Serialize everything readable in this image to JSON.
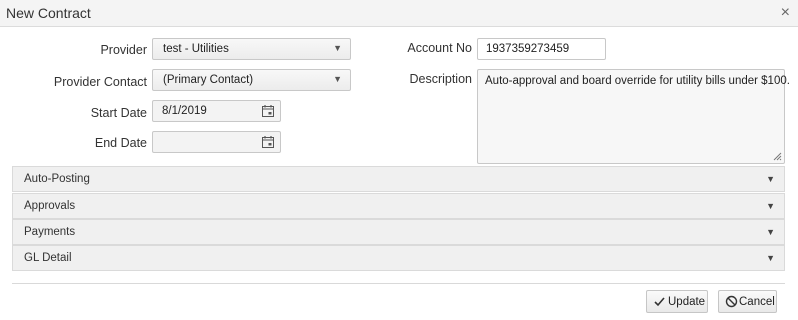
{
  "dialog": {
    "title": "New Contract"
  },
  "form": {
    "provider_label": "Provider",
    "provider_value": "test - Utilities",
    "provider_contact_label": "Provider Contact",
    "provider_contact_value": "(Primary Contact)",
    "start_date_label": "Start Date",
    "start_date_value": "8/1/2019",
    "end_date_label": "End Date",
    "end_date_value": "",
    "account_no_label": "Account No",
    "account_no_value": "1937359273459",
    "description_label": "Description",
    "description_value": "Auto-approval and board override for utility bills under $100."
  },
  "sections": [
    {
      "label": "Auto-Posting"
    },
    {
      "label": "Approvals"
    },
    {
      "label": "Payments"
    },
    {
      "label": "GL Detail"
    }
  ],
  "actions": {
    "update_label": "Update",
    "cancel_label": "Cancel"
  },
  "icons": {
    "close": "close-icon",
    "dropdown": "chevron-down-icon",
    "calendar": "calendar-icon",
    "check": "check-icon",
    "cancel": "cancel-icon"
  }
}
